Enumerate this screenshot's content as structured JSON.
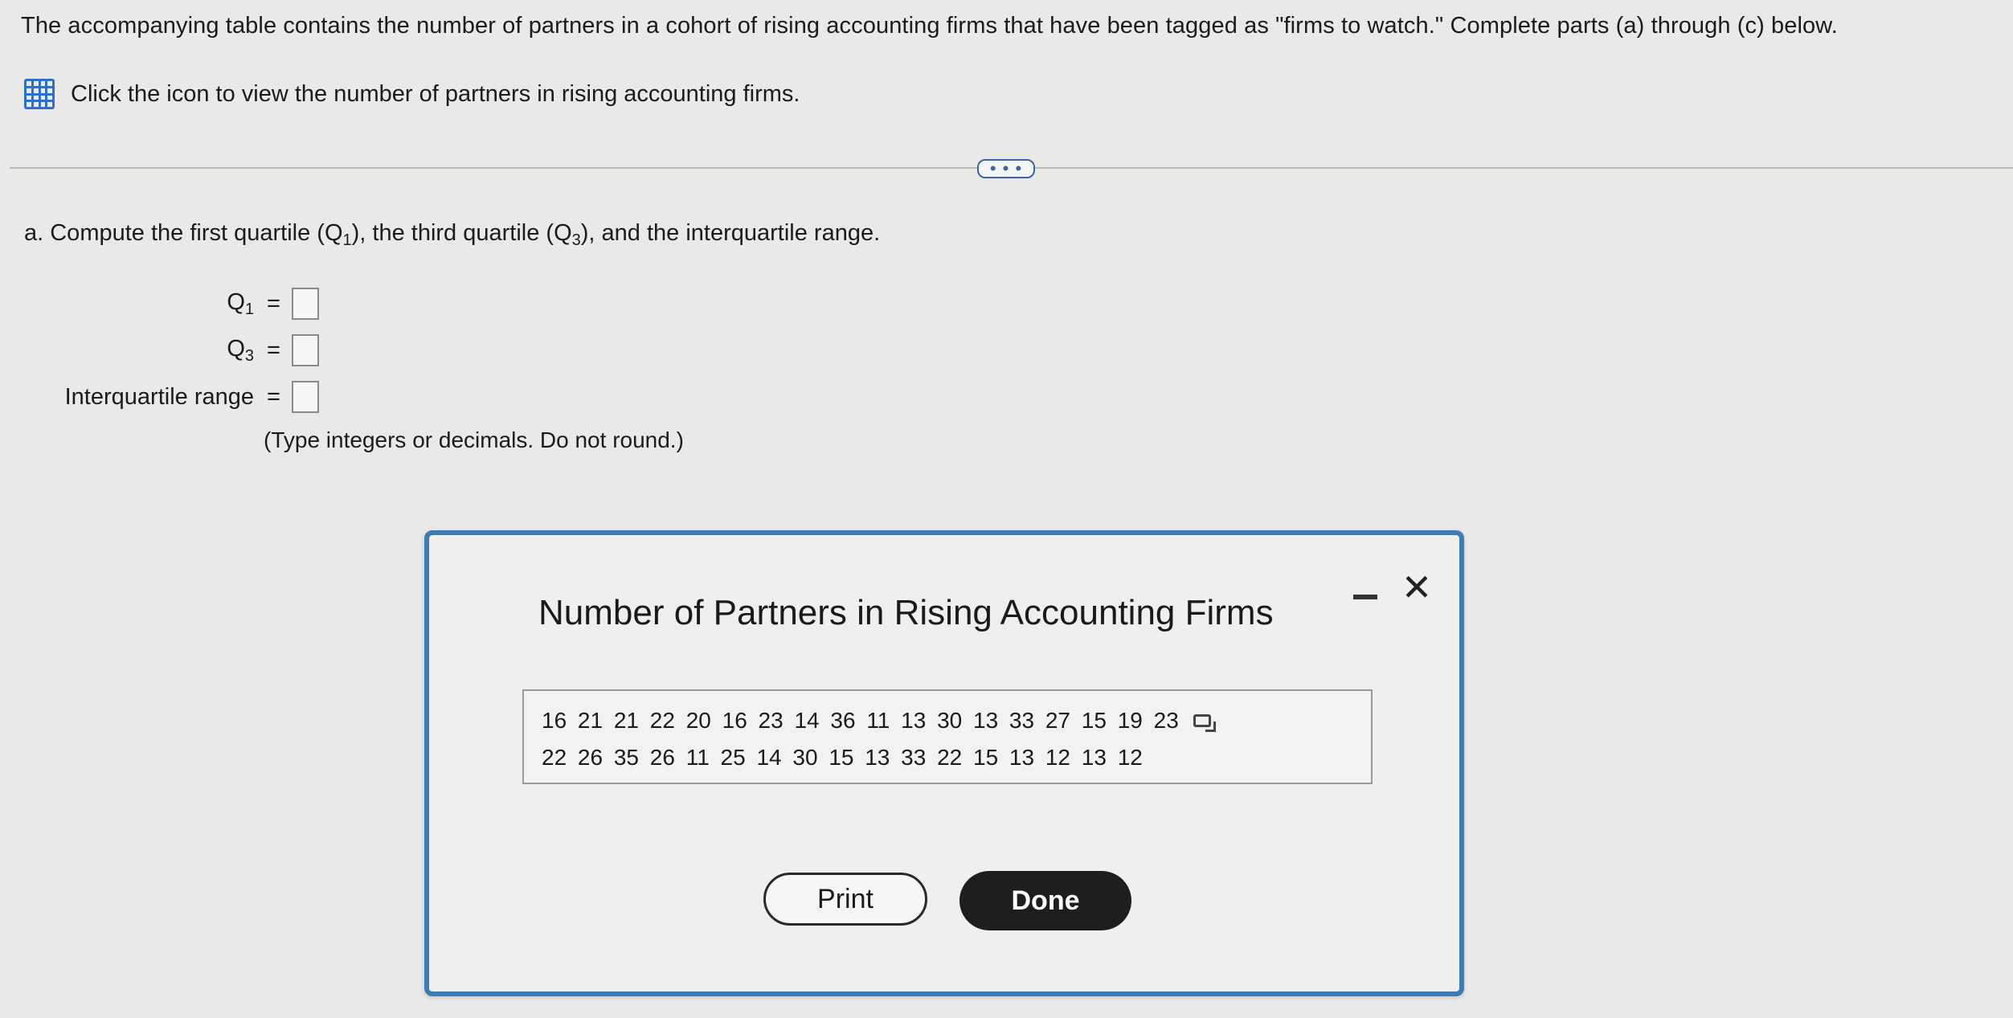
{
  "prompt": {
    "text": "The accompanying table contains the number of partners in a cohort of rising accounting firms that have been tagged as \"firms to watch.\" Complete parts (a) through (c) below."
  },
  "hint": {
    "icon": "table-grid-icon",
    "text": "Click the icon to view the number of partners in rising accounting firms."
  },
  "expand_button": {
    "label": "• • •"
  },
  "part_a": {
    "prefix": "a. Compute the first quartile (Q",
    "sub1": "1",
    "mid": "), the third quartile (Q",
    "sub2": "3",
    "suffix": "), and the interquartile range."
  },
  "answers": {
    "q1_label": "Q",
    "q1_sub": "1",
    "q3_label": "Q",
    "q3_sub": "3",
    "iqr_label": "Interquartile range",
    "equals": "=",
    "q1_value": "",
    "q3_value": "",
    "iqr_value": ""
  },
  "note": "(Type integers or decimals. Do not round.)",
  "modal": {
    "title": "Number of Partners in Rising Accounting Firms",
    "row1": "16 21 21 22 20 16 23 14 36 11 13 30 13 33 27 15 19 23",
    "row2": "22 26 35 26 11 25 14 30 15 13 33 22 15 13 12 13 12",
    "print_label": "Print",
    "done_label": "Done",
    "close_glyph": "✕"
  },
  "colors": {
    "accent_blue": "#3c7bb7",
    "icon_blue": "#2f6fd0",
    "done_bg": "#1e1e1e"
  }
}
